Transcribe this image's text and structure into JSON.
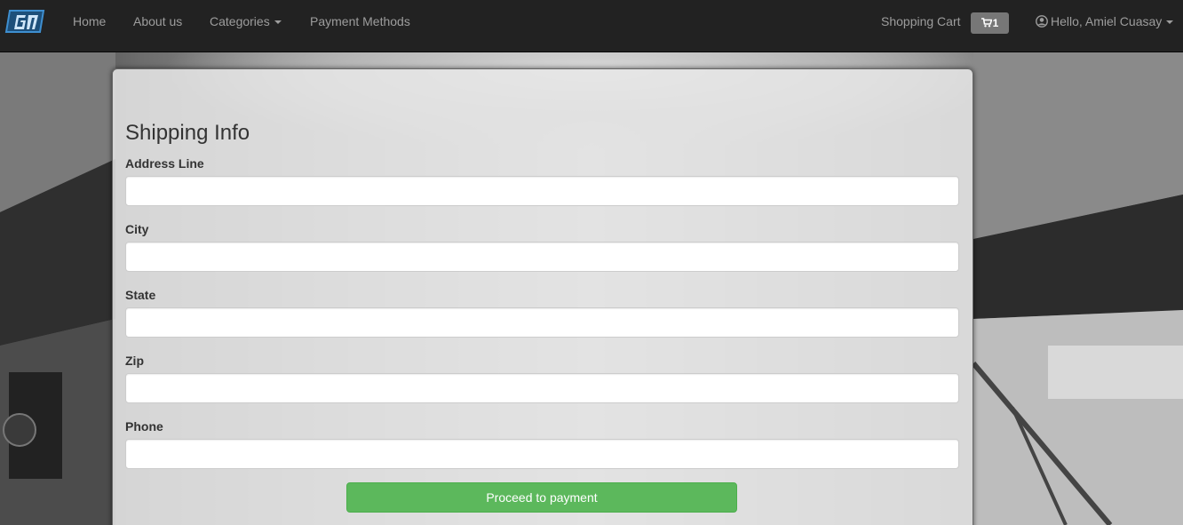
{
  "navbar": {
    "brand_icon": "store-logo-icon",
    "items": [
      {
        "label": "Home"
      },
      {
        "label": "About us"
      },
      {
        "label": "Categories"
      },
      {
        "label": "Payment Methods"
      }
    ],
    "cart_label": "Shopping Cart",
    "cart_icon": "shopping-cart-icon",
    "cart_count": "1",
    "user_icon": "user-circle-icon",
    "user_greeting": "Hello, Amiel Cuasay"
  },
  "form": {
    "title": "Shipping Info",
    "fields": [
      {
        "label": "Address Line",
        "value": ""
      },
      {
        "label": "City",
        "value": ""
      },
      {
        "label": "State",
        "value": ""
      },
      {
        "label": "Zip",
        "value": ""
      },
      {
        "label": "Phone",
        "value": ""
      }
    ],
    "submit_label": "Proceed to payment"
  },
  "colors": {
    "navbar_bg": "#222222",
    "nav_text": "#9d9d9d",
    "badge_bg": "#777777",
    "submit_bg": "#5cb85c"
  }
}
